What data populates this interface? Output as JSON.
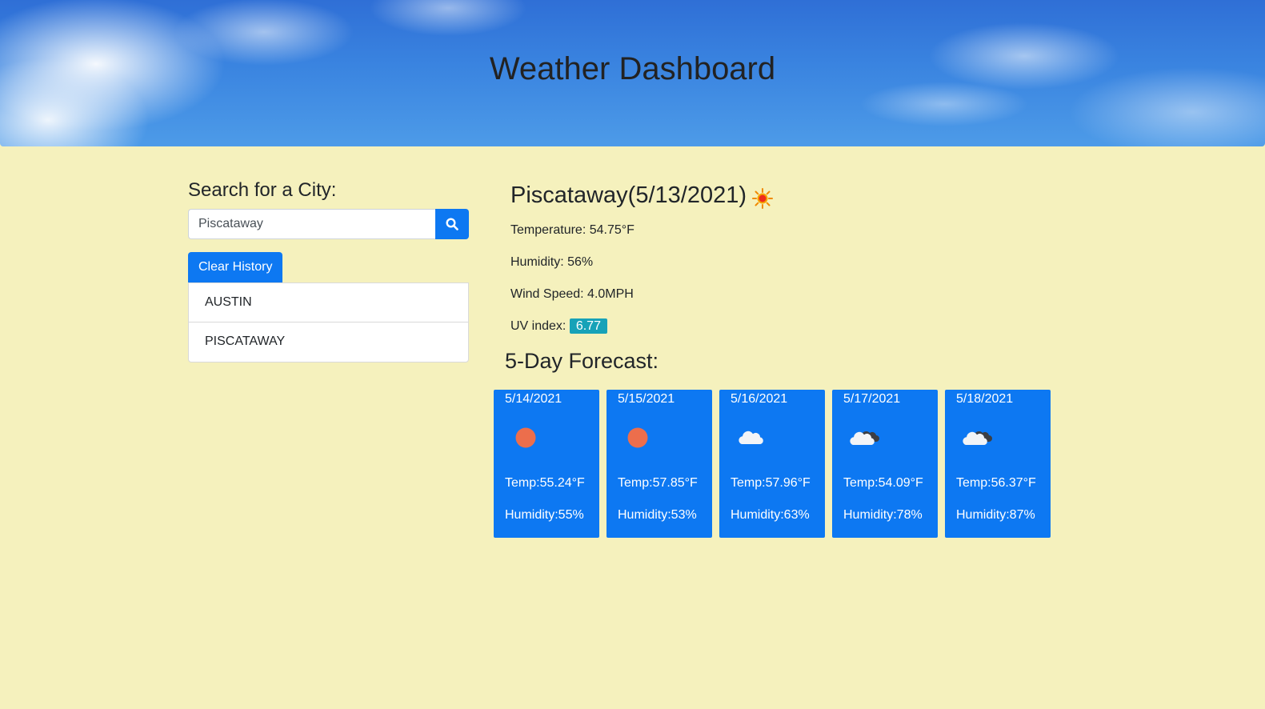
{
  "header": {
    "title": "Weather Dashboard"
  },
  "search": {
    "heading": "Search for a City:",
    "value": "Piscataway",
    "button_icon": "search-icon",
    "clear_label": "Clear History",
    "history": [
      "AUSTIN",
      "PISCATAWAY"
    ]
  },
  "current": {
    "title": "Piscataway(5/13/2021)",
    "icon": "sun-icon",
    "temperature": "Temperature: 54.75°F",
    "humidity": "Humidity: 56%",
    "wind": "Wind Speed: 4.0MPH",
    "uv_label": "UV index:",
    "uv_value": "6.77"
  },
  "forecast": {
    "heading": "5-Day Forecast:",
    "days": [
      {
        "date": "5/14/2021",
        "icon": "sun-icon",
        "temp": "Temp:55.24°F",
        "humidity": "Humidity:55%"
      },
      {
        "date": "5/15/2021",
        "icon": "sun-icon",
        "temp": "Temp:57.85°F",
        "humidity": "Humidity:53%"
      },
      {
        "date": "5/16/2021",
        "icon": "cloud-icon",
        "temp": "Temp:57.96°F",
        "humidity": "Humidity:63%"
      },
      {
        "date": "5/17/2021",
        "icon": "broken-clouds-icon",
        "temp": "Temp:54.09°F",
        "humidity": "Humidity:78%"
      },
      {
        "date": "5/18/2021",
        "icon": "broken-clouds-icon",
        "temp": "Temp:56.37°F",
        "humidity": "Humidity:87%"
      }
    ]
  },
  "colors": {
    "background": "#f5f1bd",
    "accent": "#0d78f2",
    "uv_badge": "#17a2b8"
  }
}
